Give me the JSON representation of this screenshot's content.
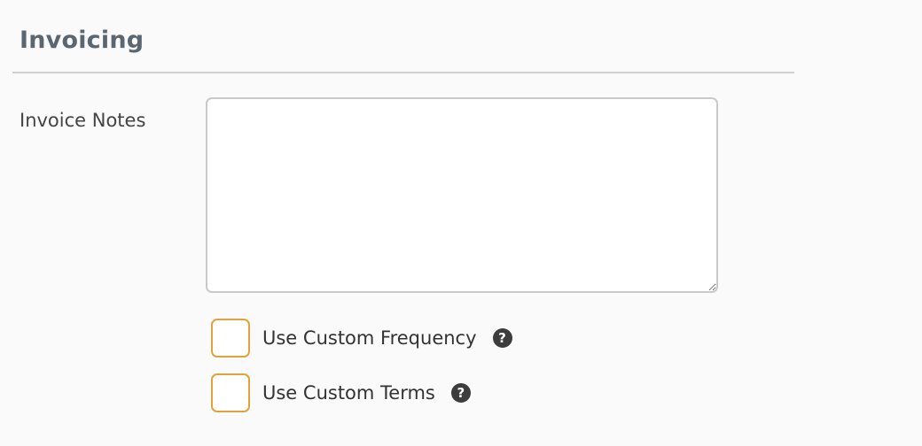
{
  "section": {
    "title": "Invoicing"
  },
  "invoice_notes": {
    "label": "Invoice Notes",
    "value": "",
    "placeholder": ""
  },
  "options": [
    {
      "label": "Use Custom Frequency",
      "checked": false,
      "help_icon": "question-circle-icon",
      "help_glyph": "?"
    },
    {
      "label": "Use Custom Terms",
      "checked": false,
      "help_icon": "question-circle-icon",
      "help_glyph": "?"
    }
  ],
  "colors": {
    "title": "#5b6770",
    "checkbox_border": "#e2a23e",
    "help_icon_bg": "#3c3c3c",
    "background": "#fafafa"
  }
}
